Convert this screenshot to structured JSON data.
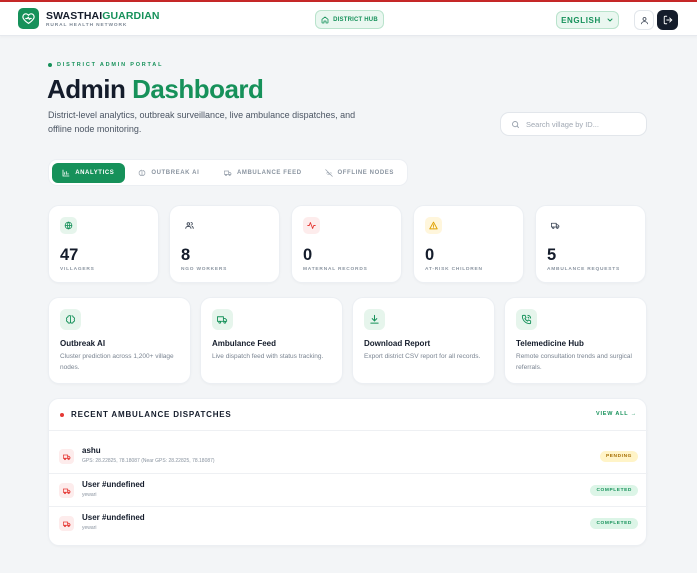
{
  "brand": {
    "name_part1": "SWASTHAI",
    "name_part2": "GUARDIAN",
    "subtitle": "RURAL HEALTH NETWORK",
    "logo_icon": "heart-pulse-icon"
  },
  "header": {
    "hub_label": "DISTRICT HUB",
    "language": "ENGLISH",
    "user_icon": "user-icon",
    "logout_icon": "logout-icon"
  },
  "hero": {
    "eyebrow": "DISTRICT ADMIN PORTAL",
    "title_part1": "Admin",
    "title_part2": "Dashboard",
    "description": "District-level analytics, outbreak surveillance, live ambulance dispatches, and offline node monitoring."
  },
  "search": {
    "placeholder": "Search village by ID..."
  },
  "tabs": [
    {
      "label": "ANALYTICS",
      "icon": "bar-chart-icon",
      "active": true
    },
    {
      "label": "OUTBREAK AI",
      "icon": "brain-icon",
      "active": false
    },
    {
      "label": "AMBULANCE FEED",
      "icon": "truck-icon",
      "active": false
    },
    {
      "label": "OFFLINE NODES",
      "icon": "wifi-off-icon",
      "active": false
    }
  ],
  "stats": [
    {
      "value": "47",
      "label": "VILLAGERS",
      "icon": "globe-icon"
    },
    {
      "value": "8",
      "label": "NGO WORKERS",
      "icon": "users-icon"
    },
    {
      "value": "0",
      "label": "MATERNAL RECORDS",
      "icon": "activity-icon"
    },
    {
      "value": "0",
      "label": "AT-RISK CHILDREN",
      "icon": "alert-triangle-icon"
    },
    {
      "value": "5",
      "label": "AMBULANCE REQUESTS",
      "icon": "truck-icon"
    }
  ],
  "features": [
    {
      "title": "Outbreak AI",
      "description": "Cluster prediction across 1,200+ village nodes.",
      "icon": "brain-icon"
    },
    {
      "title": "Ambulance Feed",
      "description": "Live dispatch feed with status tracking.",
      "icon": "truck-icon"
    },
    {
      "title": "Download Report",
      "description": "Export district CSV report for all records.",
      "icon": "download-icon"
    },
    {
      "title": "Telemedicine Hub",
      "description": "Remote consultation trends and surgical referrals.",
      "icon": "phone-call-icon"
    }
  ],
  "dispatches": {
    "title": "RECENT AMBULANCE DISPATCHES",
    "view_all": "VIEW ALL →",
    "rows": [
      {
        "name": "ashu",
        "detail": "GPS: 28.22825, 78.18087 (Near GPS: 28.22825, 78.18087)",
        "status": "PENDING"
      },
      {
        "name": "User #undefined",
        "detail": "yewari",
        "status": "COMPLETED"
      },
      {
        "name": "User #undefined",
        "detail": "yewari",
        "status": "COMPLETED"
      }
    ]
  },
  "colors": {
    "brand_green": "#16915a",
    "dark": "#141c2b",
    "alert_red": "#e53935",
    "pending_bg": "#fff4c8",
    "completed_bg": "#dcf5e7"
  }
}
